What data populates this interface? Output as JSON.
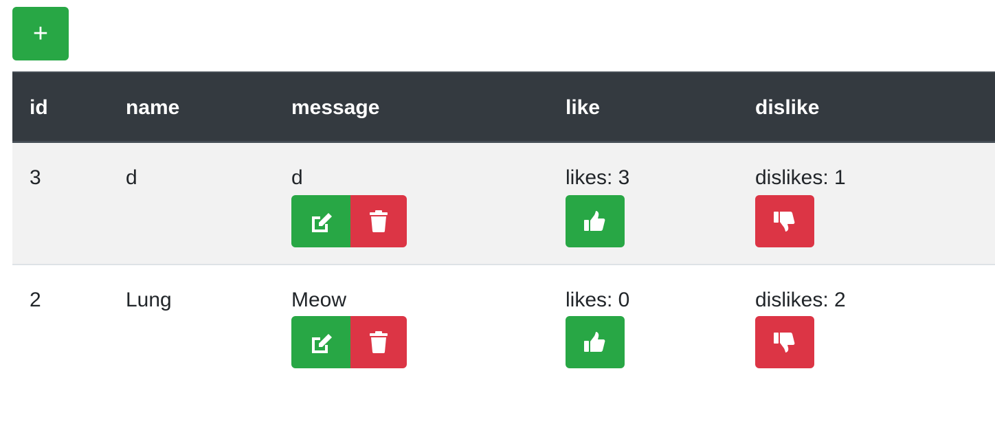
{
  "toolbar": {
    "add_label": "+"
  },
  "table": {
    "headers": {
      "id": "id",
      "name": "name",
      "message": "message",
      "like": "like",
      "dislike": "dislike"
    },
    "rows": [
      {
        "id": "3",
        "name": "d",
        "message": "d",
        "likes": "likes: 3",
        "dislikes": "dislikes: 1"
      },
      {
        "id": "2",
        "name": "Lung",
        "message": "Meow",
        "likes": "likes: 0",
        "dislikes": "dislikes: 2"
      }
    ]
  },
  "colors": {
    "success": "#28a745",
    "danger": "#dc3545",
    "header_bg": "#343a40",
    "stripe_bg": "#f2f2f2"
  },
  "icons": {
    "add": "plus-icon",
    "edit": "edit-icon",
    "delete": "trash-icon",
    "like": "thumbs-up-icon",
    "dislike": "thumbs-down-icon"
  }
}
